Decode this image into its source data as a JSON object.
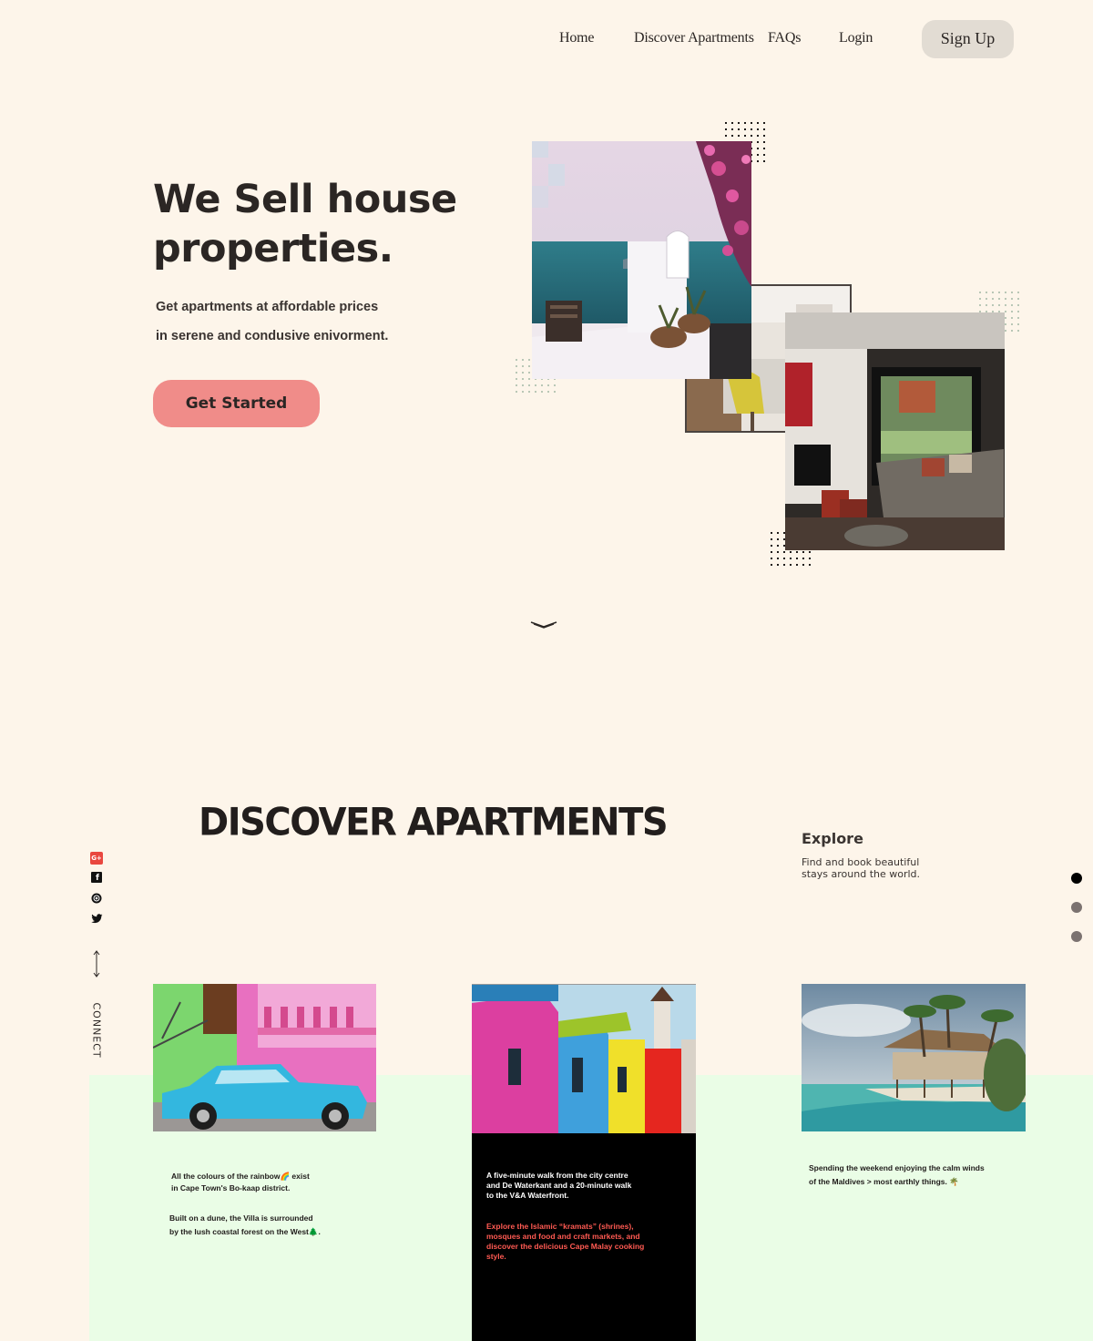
{
  "nav": {
    "items": [
      "Home",
      "Discover Apartments",
      "FAQs",
      "Login"
    ],
    "signup": "Sign Up"
  },
  "hero": {
    "title_line1": "We Sell house",
    "title_line2": "properties.",
    "sub_line1": "Get apartments at affordable prices",
    "sub_line2": "in serene and condusive enivorment.",
    "cta": "Get Started"
  },
  "discover": {
    "title": "DISCOVER APARTMENTS",
    "explore_heading": "Explore",
    "explore_line1": "Find and book beautiful",
    "explore_line2": "stays around the world."
  },
  "social": {
    "icons": [
      "google-plus-icon",
      "facebook-icon",
      "instagram-icon",
      "twitter-icon"
    ],
    "connect_label": "CONNECT"
  },
  "cards": [
    {
      "line1": "All the colours of the rainbow🌈 exist",
      "line2": "in Cape Town's Bo-kaap district.",
      "line3": "Built on a dune, the Villa is surrounded",
      "line4": "by the lush coastal forest on the West🌲."
    },
    {
      "line1": "A five-minute walk from the city centre",
      "line2": "and De Waterkant and a 20-minute walk",
      "line3": "to the V&A Waterfront.",
      "red1": "Explore the Islamic “kramats” (shrines),",
      "red2": "mosques and food and craft markets, and",
      "red3": "discover the delicious Cape Malay cooking",
      "red4": "style."
    },
    {
      "line1": "Spending the weekend enjoying the calm winds",
      "line2": "of the Maldives > most earthly things. 🌴"
    }
  ],
  "colors": {
    "background": "#fdf5ea",
    "cta": "#f08c89",
    "green_band": "#eafde6",
    "red_text": "#ff5a52"
  }
}
